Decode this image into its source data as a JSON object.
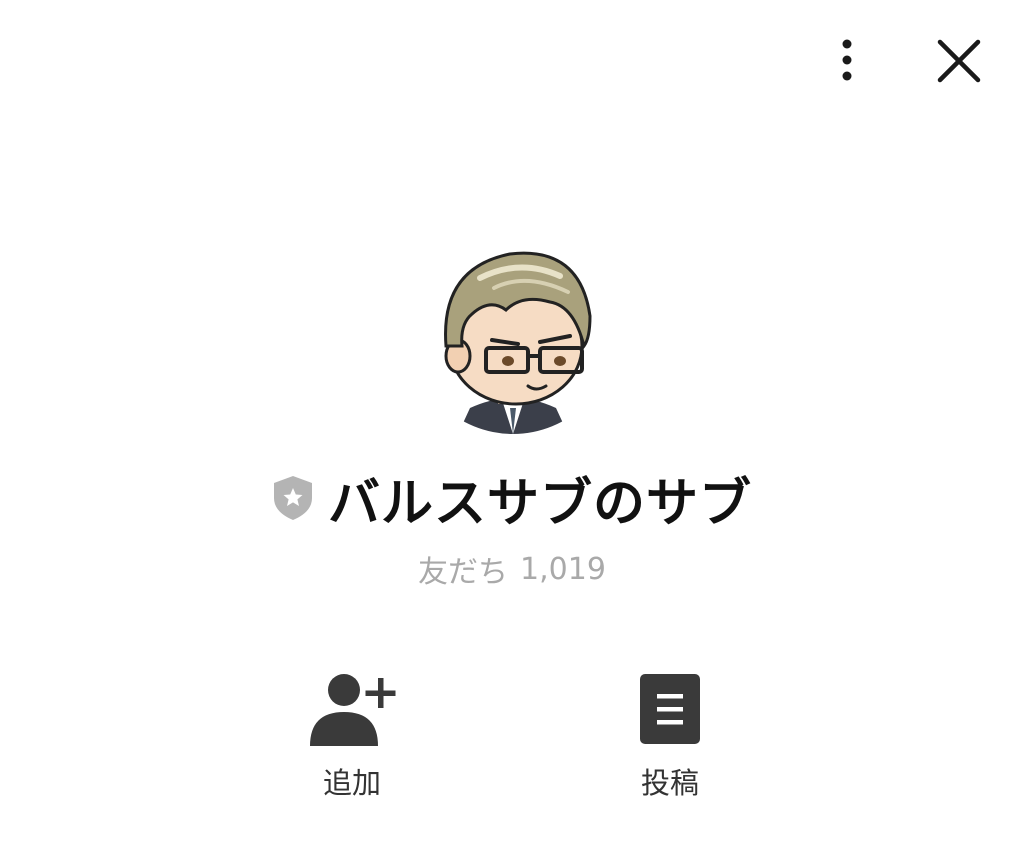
{
  "header": {
    "more_icon": "vertical-dots-icon",
    "close_icon": "close-x-icon"
  },
  "profile": {
    "name": "バルスサブのサブ",
    "badge_icon": "shield-star-icon",
    "friends_label": "友だち",
    "friends_count": "1,019"
  },
  "actions": [
    {
      "label": "追加",
      "icon": "add-friend-icon"
    },
    {
      "label": "投稿",
      "icon": "post-document-icon"
    }
  ],
  "colors": {
    "icon_dark": "#3a3a3a",
    "badge_gray": "#b4b4b4",
    "muted_text": "#a9a9a9"
  }
}
